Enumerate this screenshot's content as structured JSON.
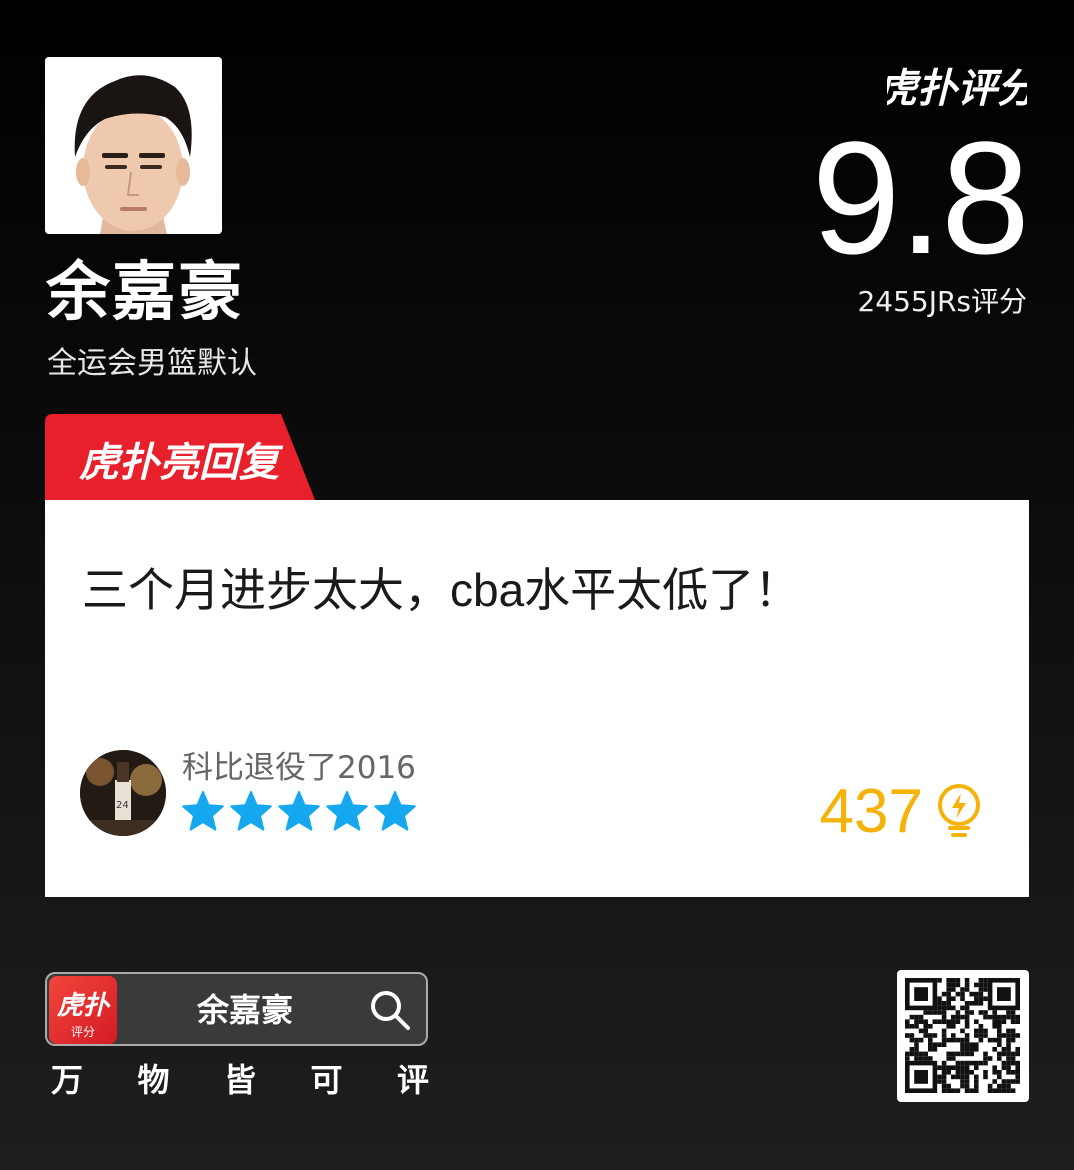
{
  "header": {
    "player_name": "余嘉豪",
    "player_team": "全运会男篮默认",
    "brand_logo_text": "虎扑评分",
    "score": "9.8",
    "score_count": "2455JRs评分"
  },
  "tag": {
    "label": "虎扑亮回复",
    "color": "#e8202b"
  },
  "comment": {
    "text": "三个月进步太大，cba水平太低了！",
    "user_name": "科比退役了2016",
    "stars": 5,
    "star_color": "#16a7ef",
    "likes": "437",
    "likes_color": "#f5b30a"
  },
  "footer": {
    "app_icon_text": "虎扑",
    "app_icon_sub": "评分",
    "search_query": "余嘉豪",
    "slogan": [
      "万",
      "物",
      "皆",
      "可",
      "评"
    ]
  },
  "icons": {
    "search": "search-icon",
    "like": "lightbulb-icon",
    "qr": "qr-code"
  }
}
